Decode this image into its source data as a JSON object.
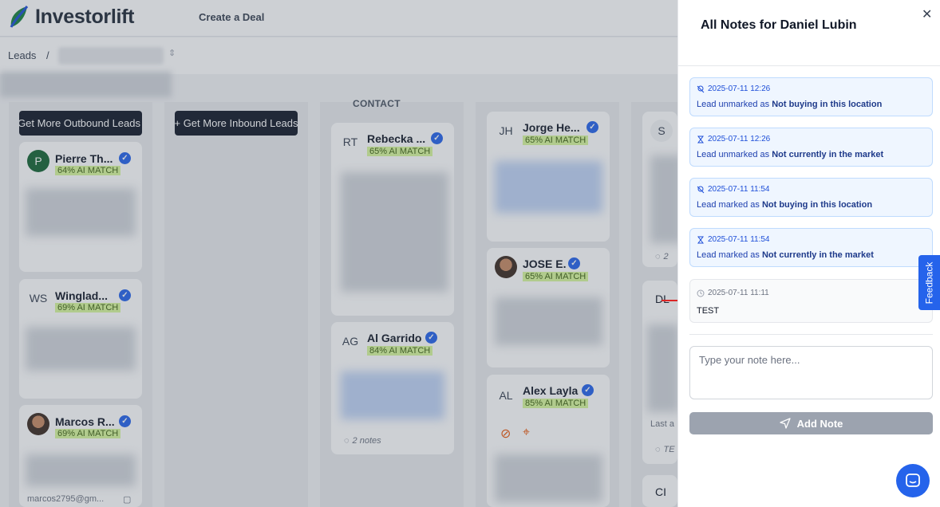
{
  "app": {
    "brand": "Investorlift",
    "nav_create_deal": "Create a Deal"
  },
  "breadcrumb": {
    "root": "Leads",
    "separator": "/"
  },
  "board": {
    "column_header": "CONTACT",
    "outbound_cta": "Get More Outbound Leads",
    "inbound_cta": "+ Get More Inbound Leads",
    "cards": [
      {
        "initials": "P",
        "name": "Pierre Th...",
        "match": "64% AI MATCH"
      },
      {
        "initials": "WS",
        "name": "Winglad...",
        "match": "69% AI MATCH"
      },
      {
        "initials": "",
        "name": "Marcos R...",
        "match": "69% AI MATCH",
        "email": "marcos2795@gm..."
      },
      {
        "initials": "RT",
        "name": "Rebecka ...",
        "match": "65% AI MATCH"
      },
      {
        "initials": "AG",
        "name": "Al Garrido",
        "match": "84% AI MATCH",
        "notes": "2 notes"
      },
      {
        "initials": "JH",
        "name": "Jorge He...",
        "match": "65% AI MATCH"
      },
      {
        "initials": "",
        "name": "JOSE E.",
        "match": "65% AI MATCH"
      },
      {
        "initials": "AL",
        "name": "Alex Layla",
        "match": "85% AI MATCH"
      },
      {
        "initials": "S",
        "name": "",
        "match": "",
        "notes": "2"
      },
      {
        "initials": "DL",
        "name": "",
        "match": "",
        "last": "Last a",
        "notes": "TE"
      },
      {
        "initials": "CI",
        "name": "",
        "match": ""
      }
    ]
  },
  "notes_panel": {
    "title": "All Notes for Daniel Lubin",
    "notes": [
      {
        "time": "2025-07-11 12:26",
        "icon": "location-off-icon",
        "action": "Lead unmarked as",
        "target": "Not buying in this location"
      },
      {
        "time": "2025-07-11 12:26",
        "icon": "hourglass-icon",
        "action": "Lead unmarked as",
        "target": "Not currently in the market"
      },
      {
        "time": "2025-07-11 11:54",
        "icon": "location-off-icon",
        "action": "Lead marked as",
        "target": "Not buying in this location"
      },
      {
        "time": "2025-07-11 11:54",
        "icon": "hourglass-icon",
        "action": "Lead marked as",
        "target": "Not currently in the market"
      },
      {
        "time": "2025-07-11 11:11",
        "icon": "clock-icon",
        "text": "TEST"
      }
    ],
    "input_placeholder": "Type your note here...",
    "add_button": "Add Note"
  },
  "feedback_label": "Feedback",
  "colors": {
    "accent": "#2563eb",
    "match_bg": "#d9f99d",
    "note_bg": "#eff6ff"
  }
}
